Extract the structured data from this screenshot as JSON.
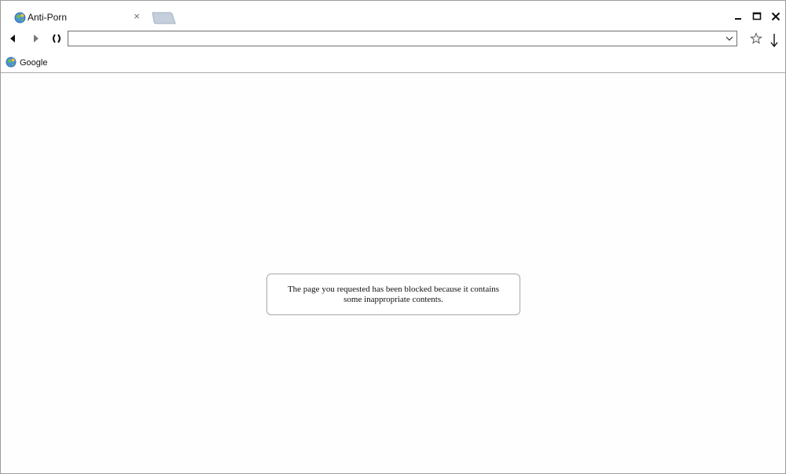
{
  "tab": {
    "title": "Anti-Porn",
    "favicon": "globe-icon",
    "close_glyph": "×"
  },
  "toolbar": {
    "address_value": "",
    "back_icon": "back-arrow-icon",
    "forward_icon": "forward-arrow-icon",
    "reload_icon": "reload-icon",
    "bookmark_icon": "star-icon",
    "download_icon": "download-icon"
  },
  "bookmarks": [
    {
      "label": "Google",
      "icon": "globe-icon"
    }
  ],
  "content": {
    "message": "The page you requested has been blocked because it contains some inappropriate contents."
  },
  "colors": {
    "window_border": "#9c9c9c",
    "new_tab_fill": "#c4cfdb",
    "separator": "#a9a9a9"
  }
}
